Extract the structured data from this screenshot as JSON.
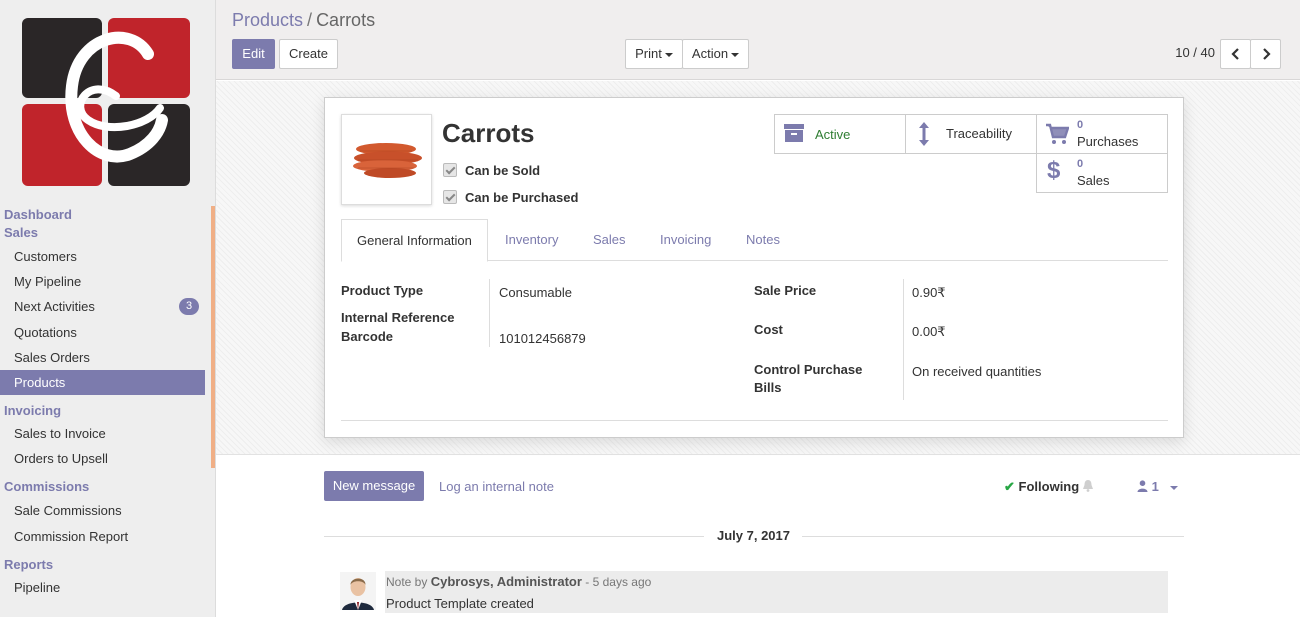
{
  "sidebar": {
    "sections": [
      {
        "label": "Dashboard"
      },
      {
        "label": "Sales"
      },
      {
        "label": "Invoicing"
      },
      {
        "label": "Commissions"
      },
      {
        "label": "Reports"
      }
    ],
    "sales_items": [
      {
        "label": "Customers"
      },
      {
        "label": "My Pipeline"
      },
      {
        "label": "Next Activities",
        "badge": "3"
      },
      {
        "label": "Quotations"
      },
      {
        "label": "Sales Orders"
      },
      {
        "label": "Products",
        "active": true
      }
    ],
    "invoicing_items": [
      {
        "label": "Sales to Invoice"
      },
      {
        "label": "Orders to Upsell"
      }
    ],
    "commissions_items": [
      {
        "label": "Sale Commissions"
      },
      {
        "label": "Commission Report"
      }
    ],
    "reports_items": [
      {
        "label": "Pipeline"
      }
    ]
  },
  "breadcrumb": {
    "parent": "Products",
    "separator": "/",
    "current": "Carrots"
  },
  "toolbar": {
    "edit": "Edit",
    "create": "Create",
    "print": "Print",
    "action": "Action"
  },
  "pager": {
    "value": "10 / 40"
  },
  "product": {
    "name": "Carrots",
    "can_be_sold": "Can be Sold",
    "can_be_purchased": "Can be Purchased"
  },
  "smart_buttons": {
    "active": "Active",
    "traceability": "Traceability",
    "purchases_count": "0",
    "purchases_label": "Purchases",
    "sales_count": "0",
    "sales_label": "Sales"
  },
  "tabs": [
    "General Information",
    "Inventory",
    "Sales",
    "Invoicing",
    "Notes"
  ],
  "fields": {
    "product_type_label": "Product Type",
    "product_type_value": "Consumable",
    "internal_ref_label": "Internal Reference",
    "barcode_label": "Barcode",
    "barcode_value": "101012456879",
    "sale_price_label": "Sale Price",
    "sale_price_value": "0.90₹",
    "cost_label": "Cost",
    "cost_value": "0.00₹",
    "control_label_1": "Control Purchase",
    "control_label_2": "Bills",
    "control_value": "On received quantities"
  },
  "chatter": {
    "new_message": "New message",
    "log_note": "Log an internal note",
    "following": "Following",
    "followers_count": "1",
    "date": "July 7, 2017",
    "msg_prefix": "Note by",
    "msg_author": "Cybrosys, Administrator",
    "msg_time": "- 5 days ago",
    "msg_body": "Product Template created"
  },
  "colors": {
    "accent": "#7c7bad",
    "active_green": "#2e7d32",
    "logo_red": "#c0242b",
    "logo_dark": "#2a2627"
  }
}
